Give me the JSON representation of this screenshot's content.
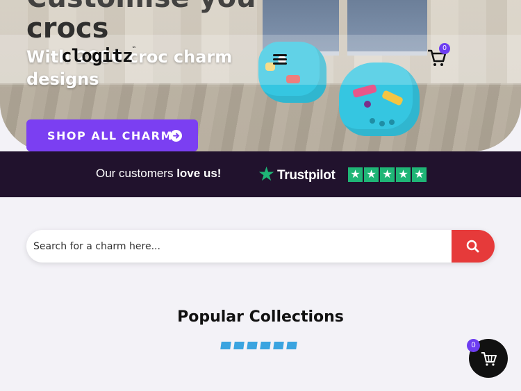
{
  "hero": {
    "title_top": "Customise you",
    "title_line": "crocs",
    "subtitle": "With 2000 croc charm designs",
    "shop_button": "SHOP ALL CHARMS"
  },
  "header": {
    "logo": "clogitz",
    "logo_tm": "™",
    "cart_count": "0"
  },
  "trust": {
    "text_prefix": "Our customers ",
    "text_bold": "love us!",
    "brand": "Trustpilot",
    "rating_stars": 5
  },
  "search": {
    "placeholder": "Search for a charm here..."
  },
  "collections": {
    "title": "Popular Collections"
  },
  "floating_cart": {
    "count": "0"
  },
  "colors": {
    "brand_purple": "#7b3ff2",
    "trust_bg": "#21122d",
    "trustpilot_green": "#1fb576",
    "search_red": "#e63a3a",
    "underline_blue": "#3aa4e0"
  }
}
